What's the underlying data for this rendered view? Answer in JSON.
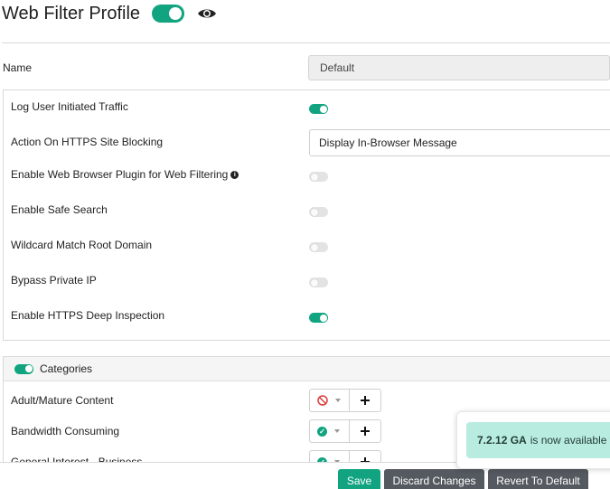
{
  "header": {
    "title": "Web Filter Profile",
    "enabled": true
  },
  "name_field": {
    "label": "Name",
    "value": "Default"
  },
  "settings": [
    {
      "label": "Log User Initiated Traffic",
      "control": "toggle",
      "on": true
    },
    {
      "label": "Action On HTTPS Site Blocking",
      "control": "select",
      "value": "Display In-Browser Message"
    },
    {
      "label": "Enable Web Browser Plugin for Web Filtering",
      "control": "toggle",
      "on": false,
      "info": true
    },
    {
      "label": "Enable Safe Search",
      "control": "toggle",
      "on": false
    },
    {
      "label": "Wildcard Match Root Domain",
      "control": "toggle",
      "on": false
    },
    {
      "label": "Bypass Private IP",
      "control": "toggle",
      "on": false
    },
    {
      "label": "Enable HTTPS Deep Inspection",
      "control": "toggle",
      "on": true
    }
  ],
  "categories": {
    "title": "Categories",
    "enabled": true,
    "rows": [
      {
        "label": "Adult/Mature Content",
        "action": "block"
      },
      {
        "label": "Bandwidth Consuming",
        "action": "allow"
      },
      {
        "label": "General Interest - Business",
        "action": "allow"
      }
    ]
  },
  "toast": {
    "version": "7.2.12 GA",
    "text": "is now available fo"
  },
  "buttons": {
    "save": "Save",
    "discard": "Discard Changes",
    "revert": "Revert To Default"
  },
  "colors": {
    "accent": "#12a480",
    "dark_button": "#555a60",
    "toast_bg": "#b9ece0",
    "block": "#e03b3b"
  }
}
